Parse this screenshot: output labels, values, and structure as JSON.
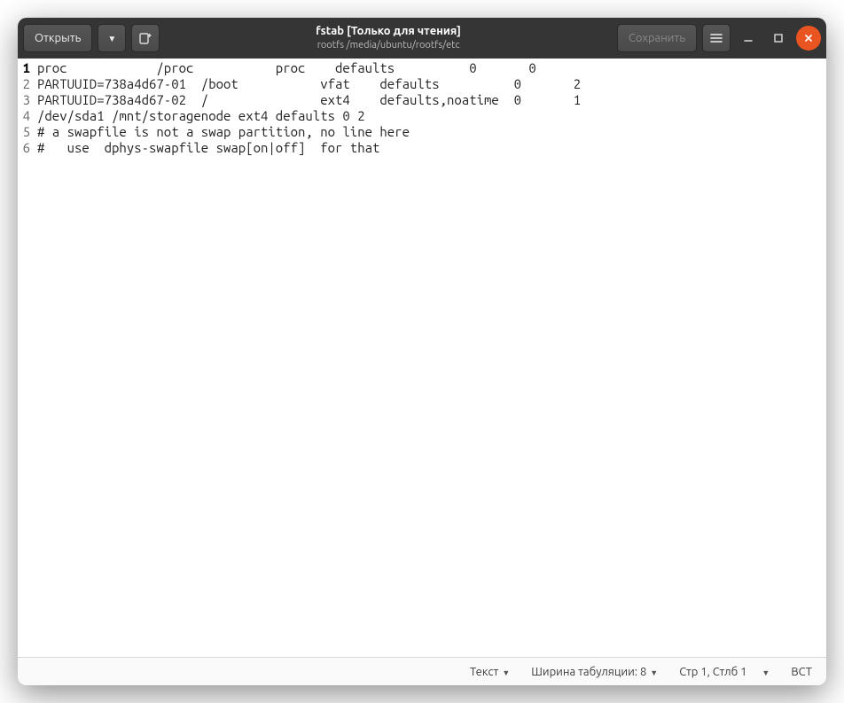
{
  "header": {
    "open_label": "Открыть",
    "title": "fstab [Только для чтения]",
    "subtitle": "rootfs /media/ubuntu/rootfs/etc",
    "save_label": "Сохранить"
  },
  "editor": {
    "current_line": 1,
    "lines": [
      "proc            /proc           proc    defaults          0       0",
      "PARTUUID=738a4d67-01  /boot           vfat    defaults          0       2",
      "PARTUUID=738a4d67-02  /               ext4    defaults,noatime  0       1",
      "/dev/sda1 /mnt/storagenode ext4 defaults 0 2",
      "# a swapfile is not a swap partition, no line here",
      "#   use  dphys-swapfile swap[on|off]  for that"
    ]
  },
  "statusbar": {
    "syntax": "Текст",
    "tab_width_label": "Ширина табуляции: 8",
    "cursor": "Стр 1, Стлб 1",
    "insert_mode": "ВСТ"
  }
}
